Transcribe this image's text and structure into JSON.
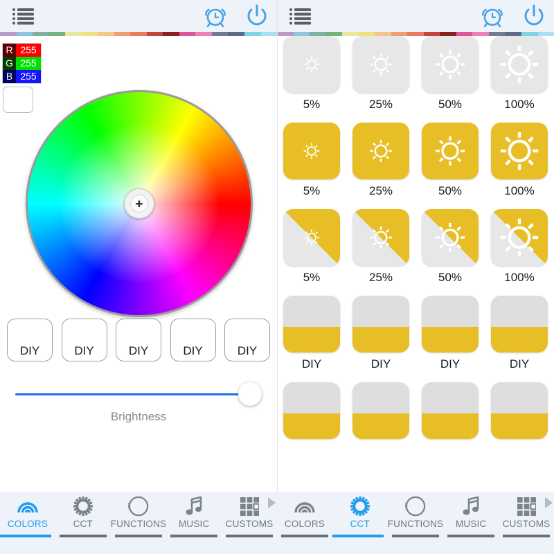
{
  "header": {
    "list_icon": "list-menu-icon",
    "alarm_icon": "alarm-clock-icon",
    "power_icon": "power-icon",
    "accent": "#46a3e8"
  },
  "strip_colors": [
    "#b79bc9",
    "#8fc4de",
    "#7fb0a0",
    "#74b47a",
    "#e8e89a",
    "#f0e07e",
    "#f2c58a",
    "#ef9d74",
    "#e97b5e",
    "#c4453c",
    "#8a1f1f",
    "#e0559a",
    "#ef7fb5",
    "#6d7b96",
    "#5d6a85",
    "#7fd3e8",
    "#a9e0ef"
  ],
  "left_panel": {
    "rgb": {
      "rows": [
        {
          "key": "R",
          "value": "255",
          "key_bg": "#5e0000",
          "value_bg": "#ff0000"
        },
        {
          "key": "G",
          "value": "255",
          "key_bg": "#003c00",
          "value_bg": "#00e000"
        },
        {
          "key": "B",
          "value": "255",
          "key_bg": "#00005e",
          "value_bg": "#1414ff"
        }
      ]
    },
    "swatch_color": "#ffffff",
    "color_wheel": {
      "name": "hsv-color-wheel",
      "cursor_position": "center",
      "selected_color": "#ffffff"
    },
    "diy_buttons": [
      {
        "label": "DIY"
      },
      {
        "label": "DIY"
      },
      {
        "label": "DIY"
      },
      {
        "label": "DIY"
      },
      {
        "label": "DIY"
      }
    ],
    "brightness": {
      "label": "Brightness",
      "value": 100,
      "fill_color": "#1a73e8"
    }
  },
  "right_panel": {
    "rows": [
      {
        "style": "plain",
        "tiles": [
          {
            "label": "5%",
            "sun_size": 26
          },
          {
            "label": "25%",
            "sun_size": 36
          },
          {
            "label": "50%",
            "sun_size": 48
          },
          {
            "label": "100%",
            "sun_size": 62
          }
        ]
      },
      {
        "style": "yellow",
        "tiles": [
          {
            "label": "5%",
            "sun_size": 26
          },
          {
            "label": "25%",
            "sun_size": 36
          },
          {
            "label": "50%",
            "sun_size": 48
          },
          {
            "label": "100%",
            "sun_size": 62
          }
        ]
      },
      {
        "style": "diagonal",
        "tiles": [
          {
            "label": "5%",
            "sun_size": 26
          },
          {
            "label": "25%",
            "sun_size": 36
          },
          {
            "label": "50%",
            "sun_size": 48
          },
          {
            "label": "100%",
            "sun_size": 62
          }
        ]
      },
      {
        "style": "half",
        "tiles": [
          {
            "label": "DIY"
          },
          {
            "label": "DIY"
          },
          {
            "label": "DIY"
          },
          {
            "label": "DIY"
          }
        ]
      },
      {
        "style": "half",
        "tiles": [
          {
            "label": ""
          },
          {
            "label": ""
          },
          {
            "label": ""
          },
          {
            "label": ""
          }
        ]
      }
    ],
    "yellow": "#e8be26",
    "gray": "#e7e7e7"
  },
  "tabbar_left": {
    "active": "COLORS",
    "tabs": [
      {
        "label": "COLORS",
        "icon": "rainbow-arc-icon"
      },
      {
        "label": "CCT",
        "icon": "sun-gear-icon"
      },
      {
        "label": "FUNCTIONS",
        "icon": "striped-circle-icon"
      },
      {
        "label": "MUSIC",
        "icon": "music-note-icon"
      },
      {
        "label": "CUSTOMS",
        "icon": "grid-squares-icon"
      }
    ]
  },
  "tabbar_right": {
    "active": "CCT",
    "tabs": [
      {
        "label": "COLORS",
        "icon": "rainbow-arc-icon"
      },
      {
        "label": "CCT",
        "icon": "sun-gear-icon"
      },
      {
        "label": "FUNCTIONS",
        "icon": "striped-circle-icon"
      },
      {
        "label": "MUSIC",
        "icon": "music-note-icon"
      },
      {
        "label": "CUSTOMS",
        "icon": "grid-squares-icon"
      }
    ]
  }
}
